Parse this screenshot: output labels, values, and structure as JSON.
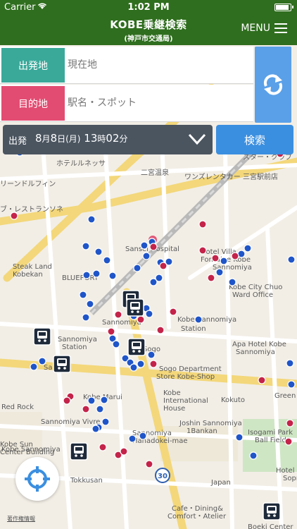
{
  "status": {
    "carrier": "Carrier",
    "time": "1:02 PM"
  },
  "header": {
    "title": "KOBE乗継検索",
    "subtitle": "(神戸市交通局)",
    "menu_label": "MENU"
  },
  "form": {
    "origin_label": "出発地",
    "origin_placeholder": "現在地",
    "dest_label": "目的地",
    "dest_placeholder": "駅名・スポット"
  },
  "datetime": {
    "mode": "出発",
    "month": "8",
    "month_unit": "月",
    "day": "8",
    "day_unit": "日",
    "weekday": "(月)",
    "hour": "13",
    "hour_unit": "時",
    "minute": "02",
    "minute_unit": "分"
  },
  "search_button": "検索",
  "copyright_label": "著作権情報",
  "map": {
    "labels": [
      "ホテルルネッサ",
      "二宮温泉",
      "ワンズレンタカー 三宮駅前店",
      "スター・クラブ",
      "リーンドルフィン",
      "ブ・レストランソネ",
      "Steak Land",
      "Kobekan",
      "BLUEPORT",
      "Sansei Hospital",
      "Hotel Villa",
      "Fontaine Kobe",
      "Sannomiya",
      "Kobe City Chuo",
      "Ward Office",
      "Sannomiya",
      "Kobe-Sannomiya",
      "Station",
      "Sannomiya",
      "Station",
      "Apa Hotel Kobe",
      "Sannomiya",
      "Sogo Department",
      "Store Kobe-Shop",
      "Kobe Marui",
      "Kobe",
      "International",
      "House",
      "Kokuto",
      "Green",
      "Red Rock",
      "Kobe Sannomiya",
      "Sannomiya Vivre",
      "Sannomiya",
      "Hanadokei-mae",
      "Joshin Sannomiya",
      "1Bankan",
      "Isogami Park",
      "Ball Field",
      "Kobe Sun",
      "Center Building",
      "Hotel Sunro",
      "Sopra Kob",
      "Japan",
      "Cafe・Dining&",
      "Comfort・Atelier",
      "Boeki Center",
      "Tokkusan",
      "Sogo",
      "Sa"
    ],
    "route_number": "30",
    "hospital_symbol": "+"
  },
  "colors": {
    "header_green": "#2f6e1e",
    "origin_teal": "#3aa99a",
    "dest_pink": "#e34c72",
    "swap_blue": "#5aa0e8",
    "search_blue": "#3b8fe0",
    "date_gray": "#4b5560",
    "bus_stop_blue": "#1f55c8",
    "bus_stop_red": "#c4234a"
  },
  "icons": [
    "wifi-icon",
    "battery-icon",
    "hamburger-icon",
    "swap-icon",
    "chevron-down-icon",
    "locate-icon",
    "bus-station-icon"
  ]
}
